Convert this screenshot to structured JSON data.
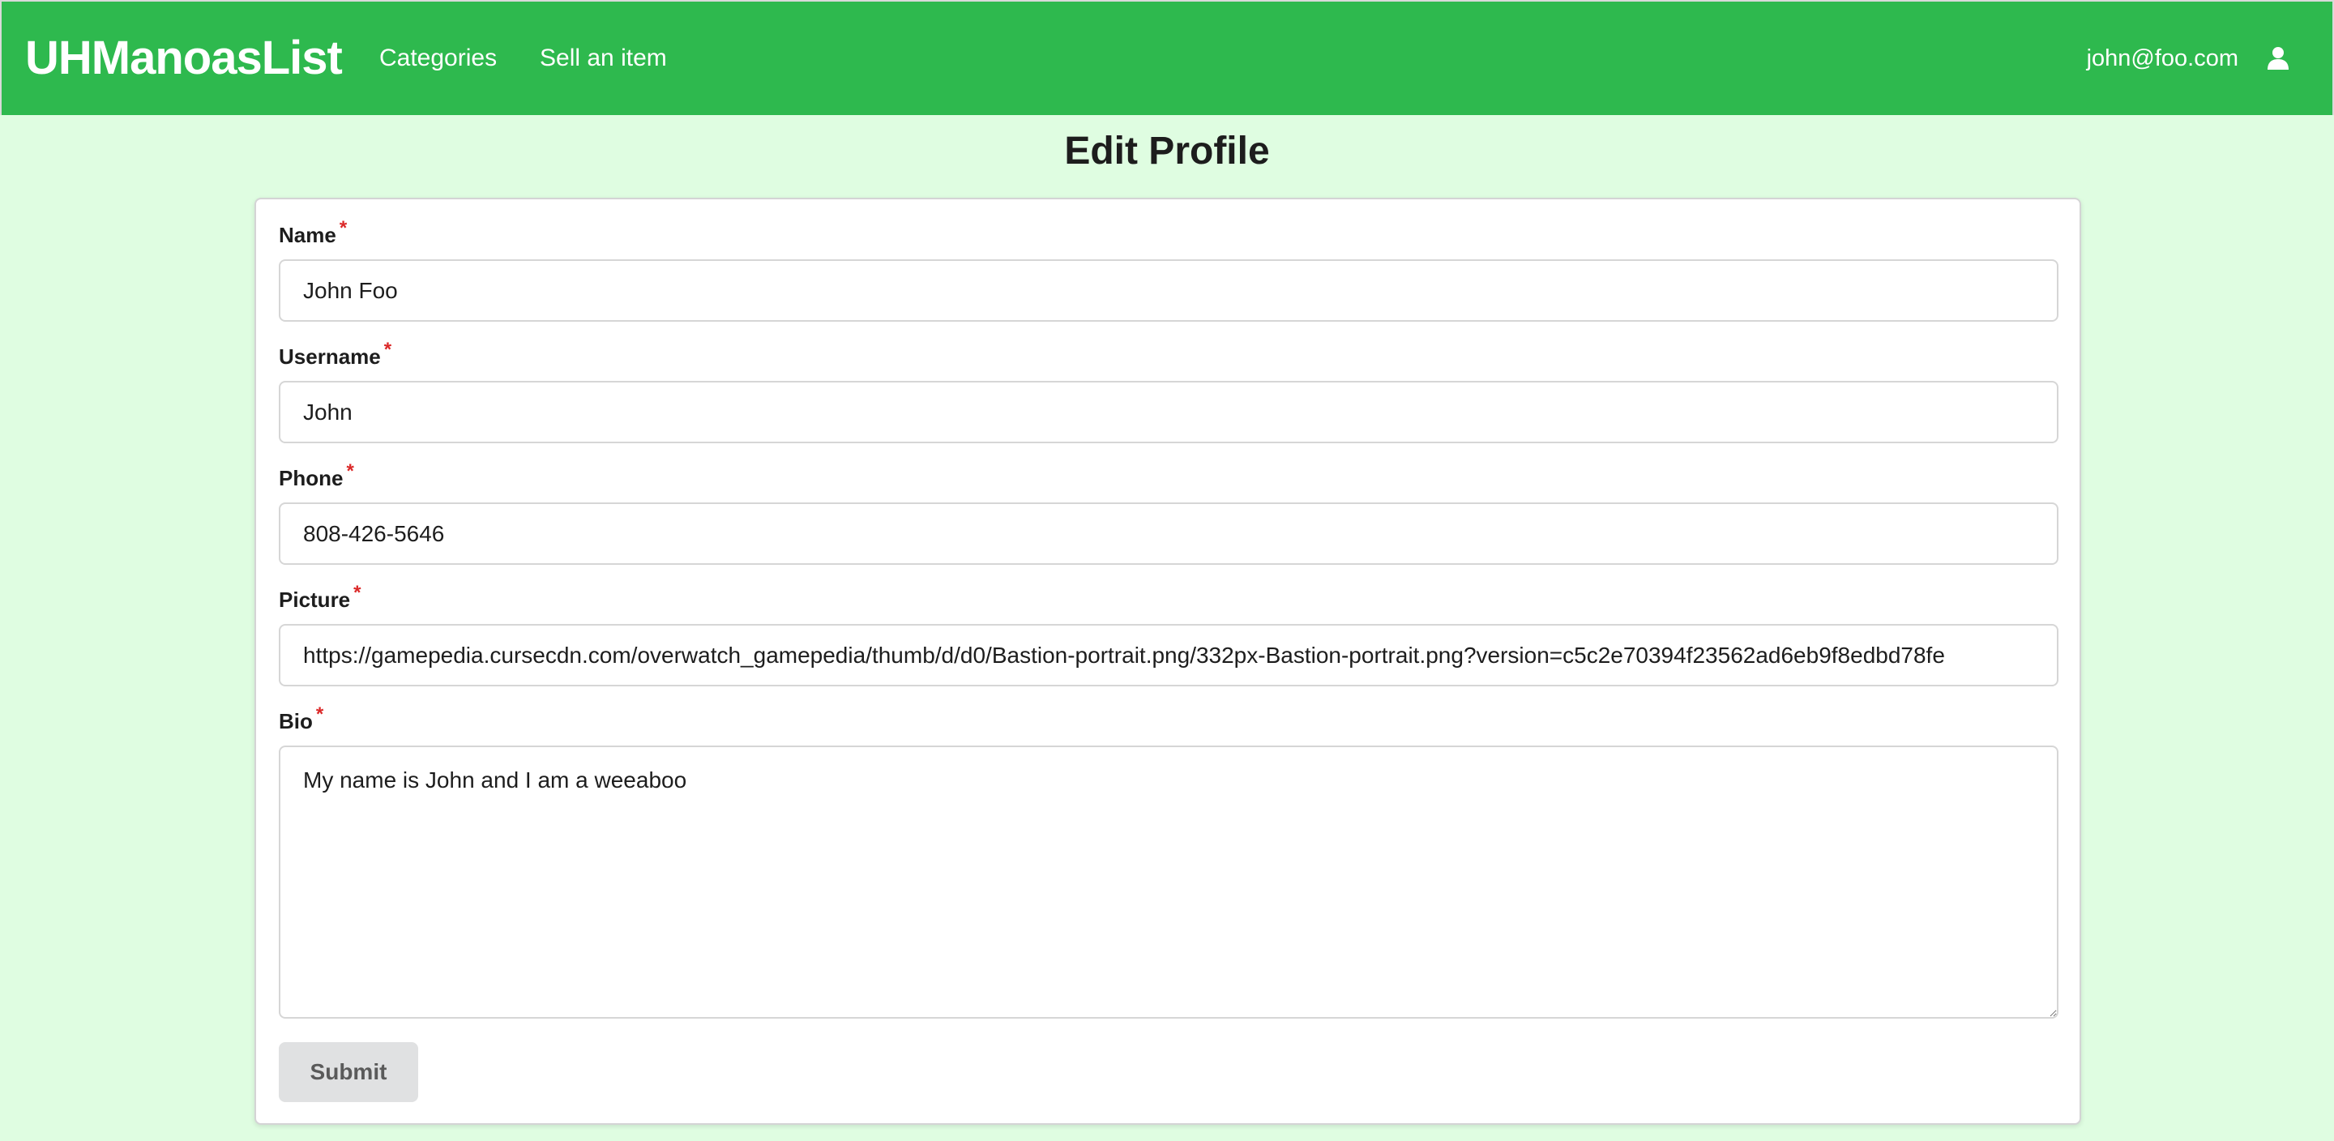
{
  "navbar": {
    "brand": "UHManoasList",
    "links": [
      {
        "label": "Categories"
      },
      {
        "label": "Sell an item"
      }
    ],
    "user_email": "john@foo.com",
    "user_icon": "user-icon",
    "background_color": "#2eb94e"
  },
  "page": {
    "title": "Edit Profile",
    "background_color": "#dffde1"
  },
  "form": {
    "required_marker": "*",
    "fields": [
      {
        "label": "Name",
        "value": "John Foo"
      },
      {
        "label": "Username",
        "value": "John"
      },
      {
        "label": "Phone",
        "value": "808-426-5646"
      },
      {
        "label": "Picture",
        "value": "https://gamepedia.cursecdn.com/overwatch_gamepedia/thumb/d/d0/Bastion-portrait.png/332px-Bastion-portrait.png?version=c5c2e70394f23562ad6eb9f8edbd78fe"
      },
      {
        "label": "Bio",
        "value": "My name is John and I am a weeaboo"
      }
    ],
    "submit_label": "Submit"
  }
}
